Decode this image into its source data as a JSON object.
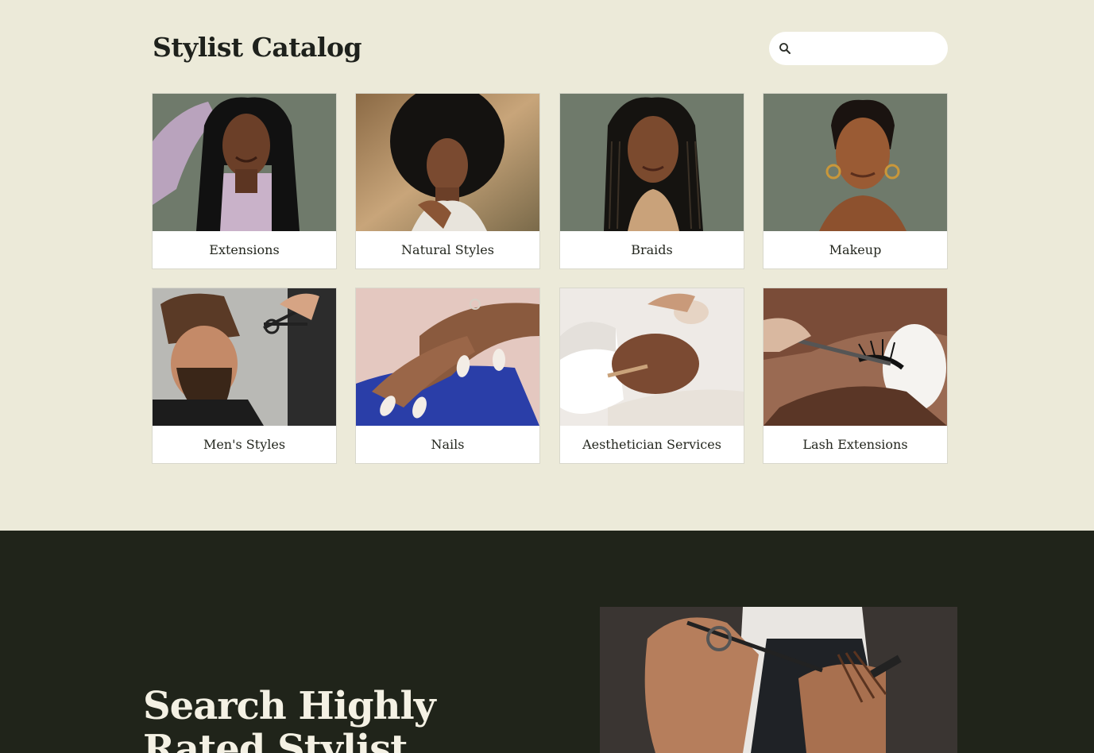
{
  "catalog": {
    "title": "Stylist Catalog",
    "search": {
      "value": "",
      "placeholder": ""
    },
    "categories": [
      {
        "label": "Extensions"
      },
      {
        "label": "Natural Styles"
      },
      {
        "label": "Braids"
      },
      {
        "label": "Makeup"
      },
      {
        "label": "Men's Styles"
      },
      {
        "label": "Nails"
      },
      {
        "label": "Aesthetician Services"
      },
      {
        "label": "Lash Extensions"
      }
    ]
  },
  "hero": {
    "title": "Search Highly Rated Stylist"
  },
  "colors": {
    "page_bg": "#ecead9",
    "hero_bg": "#20241a",
    "card_photo_green": "#6f7a6b",
    "text_dark": "#1e211c",
    "text_light": "#f4f1e4"
  }
}
